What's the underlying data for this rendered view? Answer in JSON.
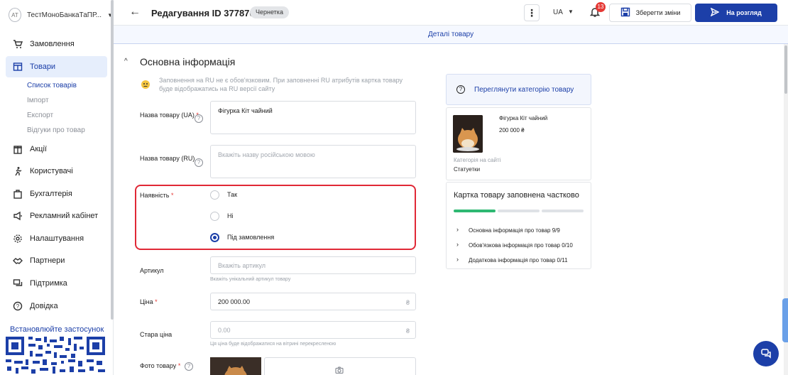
{
  "sidebar": {
    "avatar": "AT",
    "shop_name": "ТестМоноБанкаТаПР...",
    "items": [
      {
        "label": "Замовлення"
      },
      {
        "label": "Товари"
      },
      {
        "label": "Акції"
      },
      {
        "label": "Користувачі"
      },
      {
        "label": "Бухгалтерія"
      },
      {
        "label": "Рекламний кабінет"
      },
      {
        "label": "Налаштування"
      },
      {
        "label": "Партнери"
      },
      {
        "label": "Підтримка"
      },
      {
        "label": "Довідка"
      }
    ],
    "subitems": [
      {
        "label": "Список товарів"
      },
      {
        "label": "Імпорт"
      },
      {
        "label": "Експорт"
      },
      {
        "label": "Відгуки про товар"
      }
    ],
    "install_app": "Встановлюйте застосунок"
  },
  "topbar": {
    "title": "Редагування ID 377870",
    "status_badge": "Чернетка",
    "lang": "UA",
    "notifications_count": "13",
    "save_label": "Зберегти зміни",
    "submit_label": "На розгляд"
  },
  "tab": {
    "label": "Деталі товару"
  },
  "section": {
    "title": "Основна інформація",
    "note": "Заповнення на RU не є обов'язковим. При заповненні RU атрибутів картка товару буде відображатись на RU версії сайту"
  },
  "form": {
    "name_ua": {
      "label": "Назва товару (UA)",
      "required": "*",
      "value": "Фігурка Кіт чайний"
    },
    "name_ru": {
      "label": "Назва товару (RU)",
      "placeholder": "Вкажіть назву російською мовою"
    },
    "availability": {
      "label": "Наявність",
      "required": "*",
      "options": [
        {
          "label": "Так",
          "selected": false
        },
        {
          "label": "Ні",
          "selected": false
        },
        {
          "label": "Під замовлення",
          "selected": true
        }
      ]
    },
    "sku": {
      "label": "Артикул",
      "placeholder": "Вкажіть артикул",
      "hint": "Вкажіть унікальний артикул товару"
    },
    "price": {
      "label": "Ціна",
      "required": "*",
      "value": "200 000.00",
      "currency": "₴"
    },
    "old_price": {
      "label": "Стара ціна",
      "value": "0.00",
      "currency": "₴",
      "hint": "Ця ціна буде відображатися на вітрині перекресленою"
    },
    "photo": {
      "label": "Фото товару",
      "required": "*"
    }
  },
  "right": {
    "category_link": "Переглянути категорію товару",
    "preview": {
      "name": "Фігурка Кіт чайний",
      "price": "200 000 ₴",
      "category_label": "Категорія на сайті",
      "category": "Статуетки"
    },
    "fill": {
      "title": "Картка товару заповнена частково",
      "progress_segments_filled": 1,
      "progress_segments_total": 3,
      "items": [
        {
          "label": "Основна інформація про товар 9/9"
        },
        {
          "label": "Обов'язкова інформація про товар 0/10"
        },
        {
          "label": "Додаткова інформація про товар 0/11"
        }
      ]
    }
  },
  "colors": {
    "accent": "#1c3fa8",
    "highlight": "#e02836",
    "success": "#2eb872",
    "badge": "#e53935"
  }
}
